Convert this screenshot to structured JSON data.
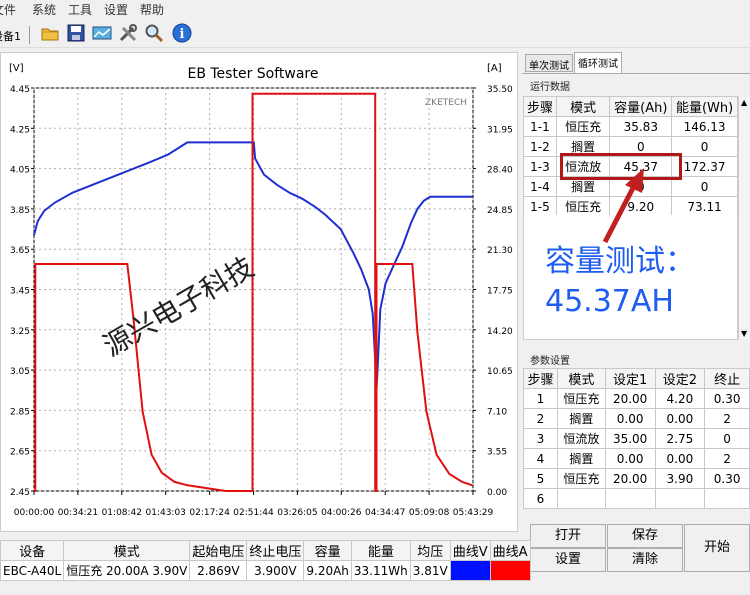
{
  "menu": {
    "items": [
      "文件",
      "系统",
      "工具",
      "设置",
      "帮助"
    ]
  },
  "toolbar": {
    "device_tab": "设备1"
  },
  "chart": {
    "title": "EB Tester Software",
    "left_unit": "[V]",
    "right_unit": "[A]",
    "brand": "ZKETECH",
    "voltage_color": "#1f2fd0",
    "current_color": "#e01010"
  },
  "chart_data": {
    "type": "line",
    "title": "EB Tester Software",
    "x_ticks": [
      "00:00:00",
      "00:34:21",
      "01:08:42",
      "01:43:03",
      "02:17:24",
      "02:51:44",
      "03:26:05",
      "04:00:26",
      "04:34:47",
      "05:09:08",
      "05:43:29"
    ],
    "y_left_ticks": [
      "4.45",
      "4.25",
      "4.05",
      "3.85",
      "3.65",
      "3.45",
      "3.25",
      "3.05",
      "2.85",
      "2.65",
      "2.45"
    ],
    "y_right_ticks": [
      "35.50",
      "31.95",
      "28.40",
      "24.85",
      "21.30",
      "17.75",
      "14.20",
      "10.65",
      "7.10",
      "3.55",
      "0.00"
    ],
    "ylim_left": [
      2.45,
      4.45
    ],
    "ylim_right": [
      0,
      35.5
    ],
    "xlim_minutes": [
      0,
      343.5
    ],
    "series": [
      {
        "axis": "left",
        "points": [
          [
            0,
            3.72
          ],
          [
            3,
            3.79
          ],
          [
            8,
            3.84
          ],
          [
            16,
            3.88
          ],
          [
            30,
            3.93
          ],
          [
            50,
            3.98
          ],
          [
            70,
            4.03
          ],
          [
            90,
            4.08
          ],
          [
            105,
            4.12
          ],
          [
            115,
            4.16
          ],
          [
            120,
            4.18
          ],
          [
            150,
            4.18
          ],
          [
            172,
            4.18
          ],
          [
            173,
            4.1
          ],
          [
            180,
            4.02
          ],
          [
            190,
            3.97
          ],
          [
            200,
            3.93
          ],
          [
            210,
            3.9
          ],
          [
            220,
            3.86
          ],
          [
            228,
            3.82
          ],
          [
            240,
            3.75
          ],
          [
            250,
            3.63
          ],
          [
            256,
            3.55
          ],
          [
            262,
            3.45
          ],
          [
            265,
            3.33
          ],
          [
            267,
            3.1
          ],
          [
            268,
            2.95
          ],
          [
            269,
            3.08
          ],
          [
            271,
            3.35
          ],
          [
            275,
            3.48
          ],
          [
            280,
            3.55
          ],
          [
            288,
            3.66
          ],
          [
            295,
            3.78
          ],
          [
            300,
            3.85
          ],
          [
            305,
            3.89
          ],
          [
            310,
            3.91
          ],
          [
            343,
            3.91
          ]
        ]
      },
      {
        "axis": "right",
        "points": [
          [
            0,
            0
          ],
          [
            1,
            0
          ],
          [
            1,
            20
          ],
          [
            73,
            20
          ],
          [
            73,
            20
          ],
          [
            78,
            15
          ],
          [
            85,
            7
          ],
          [
            92,
            3.2
          ],
          [
            100,
            1.6
          ],
          [
            110,
            0.8
          ],
          [
            120,
            0.5
          ],
          [
            150,
            0
          ],
          [
            171,
            0
          ],
          [
            171,
            35
          ],
          [
            242,
            35
          ],
          [
            242,
            35
          ],
          [
            267,
            35
          ],
          [
            267,
            0
          ],
          [
            268,
            0
          ],
          [
            268,
            20
          ],
          [
            272,
            20
          ],
          [
            272,
            20
          ],
          [
            296,
            20
          ],
          [
            300,
            14
          ],
          [
            307,
            7
          ],
          [
            315,
            3.2
          ],
          [
            325,
            1.5
          ],
          [
            335,
            0.8
          ],
          [
            343,
            0.5
          ]
        ]
      }
    ]
  },
  "tabs": [
    "单次测试",
    "循环测试"
  ],
  "run_data": {
    "label": "运行数据",
    "headers": [
      "步骤",
      "模式",
      "容量(Ah)",
      "能量(Wh)"
    ],
    "rows": [
      [
        "1-1",
        "恒压充",
        "35.83",
        "146.13"
      ],
      [
        "1-2",
        "搁置",
        "0",
        "0"
      ],
      [
        "1-3",
        "恒流放",
        "45.37",
        "172.37"
      ],
      [
        "1-4",
        "搁置",
        "0",
        "0"
      ],
      [
        "1-5",
        "恒压充",
        "9.20",
        "73.11"
      ]
    ]
  },
  "params": {
    "label": "参数设置",
    "headers": [
      "步骤",
      "模式",
      "设定1",
      "设定2",
      "终止"
    ],
    "rows": [
      [
        "1",
        "恒压充",
        "20.00",
        "4.20",
        "0.30"
      ],
      [
        "2",
        "搁置",
        "0.00",
        "0.00",
        "2"
      ],
      [
        "3",
        "恒流放",
        "35.00",
        "2.75",
        "0"
      ],
      [
        "4",
        "搁置",
        "0.00",
        "0.00",
        "2"
      ],
      [
        "5",
        "恒压充",
        "20.00",
        "3.90",
        "0.30"
      ],
      [
        "6",
        "",
        "",
        "",
        ""
      ]
    ]
  },
  "buttons": {
    "open": "打开",
    "save": "保存",
    "start": "开始",
    "settings": "设置",
    "clear": "清除"
  },
  "annotation": {
    "line1": "容量测试：",
    "line2": "45.37AH",
    "color": "#1e5cf2",
    "highlight_color": "#c02020"
  },
  "watermark": "源兴电子科技",
  "device_table": {
    "headers": [
      "设备",
      "模式",
      "起始电压",
      "终止电压",
      "容量",
      "能量",
      "均压",
      "曲线V",
      "曲线A"
    ],
    "row": [
      "EBC-A40L",
      "恒压充 20.00A 3.90V",
      "2.869V",
      "3.900V",
      "9.20Ah",
      "33.11Wh",
      "3.81V",
      "",
      ""
    ]
  }
}
